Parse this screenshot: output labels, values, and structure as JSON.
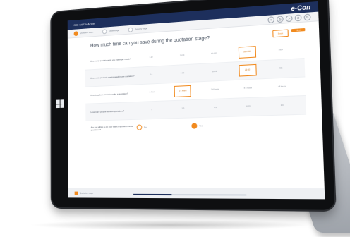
{
  "header": {
    "title": "ROI ESTIMATOR",
    "brand": "e-Con"
  },
  "nav": {
    "steps": [
      {
        "label": "Quotation stage",
        "active": true
      },
      {
        "label": "Order stage",
        "active": false
      },
      {
        "label": "Delivery stage",
        "active": false
      }
    ],
    "tools": [
      "help-icon",
      "print-icon",
      "share-icon",
      "settings-icon",
      "refresh-icon"
    ]
  },
  "question": {
    "title": "How much time can you save during the quotation stage?",
    "back_label": "Back",
    "next_label": "Next"
  },
  "rows": [
    {
      "text": "How many quotations do you make per month?",
      "options": [
        "1-10",
        "10-50",
        "50-100",
        "100-500",
        "500+"
      ],
      "selected": 3
    },
    {
      "text": "How many products are included in one quotation?",
      "options": [
        "1-5",
        "5-10",
        "10-20",
        "20-50",
        "50+"
      ],
      "selected": 3
    },
    {
      "text": "How long does it take to make a quotation?",
      "options": [
        "<1 hour",
        "1-2 hours",
        "2-4 hours",
        "4-8 hours",
        ">8 hours"
      ],
      "selected": 1
    },
    {
      "text": "How many people work on quotations?",
      "options": [
        "1",
        "2-3",
        "4-5",
        "6-10",
        "10+"
      ],
      "selected": -1
    }
  ],
  "choice": {
    "text": "Are you willing to let your sales engineers create quotations?",
    "options": [
      {
        "label": "No",
        "on": false
      },
      {
        "label": "Yes",
        "on": true
      }
    ]
  },
  "footer": {
    "text": "Quotation stage",
    "progress": 0.35
  },
  "colors": {
    "accent": "#f18a1e",
    "navy": "#1d2f5c"
  }
}
